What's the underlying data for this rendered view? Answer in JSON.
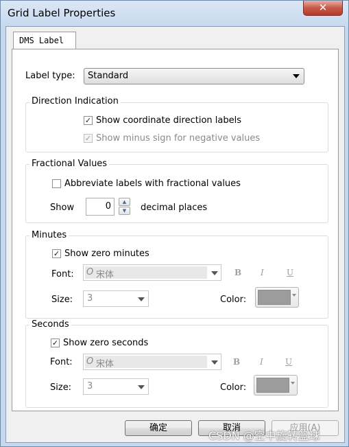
{
  "window": {
    "title": "Grid Label Properties",
    "close_label": "✕"
  },
  "tab": {
    "label": "DMS Label"
  },
  "label_type": {
    "label": "Label type:",
    "value": "Standard"
  },
  "direction": {
    "legend": "Direction Indication",
    "show_coord": {
      "label": "Show coordinate direction labels",
      "checked": "✓"
    },
    "show_minus": {
      "label": "Show minus sign for negative values",
      "checked": "✓"
    }
  },
  "fractional": {
    "legend": "Fractional Values",
    "abbreviate": {
      "label": "Abbreviate labels with fractional values",
      "checked": ""
    },
    "show_label": "Show",
    "decimal_value": "0",
    "decimal_label": "decimal places"
  },
  "minutes": {
    "legend": "Minutes",
    "show_zero": {
      "label": "Show zero minutes",
      "checked": "✓"
    },
    "font_label": "Font:",
    "font_icon": "O",
    "font_value": "宋体",
    "bold": "B",
    "italic": "I",
    "underline": "U",
    "size_label": "Size:",
    "size_value": "3",
    "color_label": "Color:",
    "color": "#9c9c9c"
  },
  "seconds": {
    "legend": "Seconds",
    "show_zero": {
      "label": "Show zero seconds",
      "checked": "✓"
    },
    "font_label": "Font:",
    "font_icon": "O",
    "font_value": "宋体",
    "bold": "B",
    "italic": "I",
    "underline": "U",
    "size_label": "Size:",
    "size_value": "3",
    "color_label": "Color:",
    "color": "#9c9c9c"
  },
  "buttons": {
    "ok": "确定",
    "cancel": "取消",
    "apply": "应用(A)"
  },
  "watermark": "CSDN @空中旋转篮球"
}
